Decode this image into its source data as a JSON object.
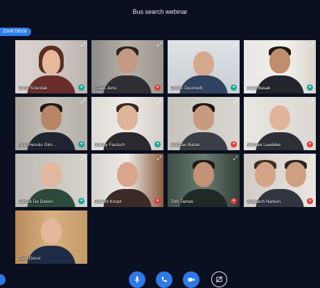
{
  "window": {
    "title": "Bus search webinar"
  },
  "presenter_tag": "Zsolt Dézsi",
  "colors": {
    "accent": "#2f78e8",
    "mic_on": "#1aa59a",
    "mic_off": "#e23a3a",
    "background": "#0a1020"
  },
  "participants": [
    {
      "name": "Anna Sclerdak",
      "status": "mic-on"
    },
    {
      "name": "Csaki Jeno",
      "status": "mic-off"
    },
    {
      "name": "Dimitri Desmedt",
      "status": "mic-on"
    },
    {
      "name": "Irsad Basak",
      "status": "mic-on"
    },
    {
      "name": "Lluis Hervás Gim...",
      "status": "mic-on"
    },
    {
      "name": "Mandy Fautsch",
      "status": "mic-on"
    },
    {
      "name": "Mertcan Bahar",
      "status": "mic-off"
    },
    {
      "name": "Michael Luedeke",
      "status": "mic-off"
    },
    {
      "name": "Patrick De Deken",
      "status": "mic-on"
    },
    {
      "name": "Roland Knopf",
      "status": "mic-off"
    },
    {
      "name": "Toth Tamas",
      "status": "mic-off"
    },
    {
      "name": "Wojciech Narkun",
      "status": "mic-off"
    },
    {
      "name": "Zsolt Dézsi",
      "status": "none"
    }
  ],
  "controls": [
    {
      "name": "microphone-button",
      "icon": "microphone-icon"
    },
    {
      "name": "hangup-button",
      "icon": "phone-icon"
    },
    {
      "name": "camera-button",
      "icon": "video-camera-icon"
    },
    {
      "name": "screen-share-button",
      "icon": "screen-share-off-icon"
    }
  ]
}
